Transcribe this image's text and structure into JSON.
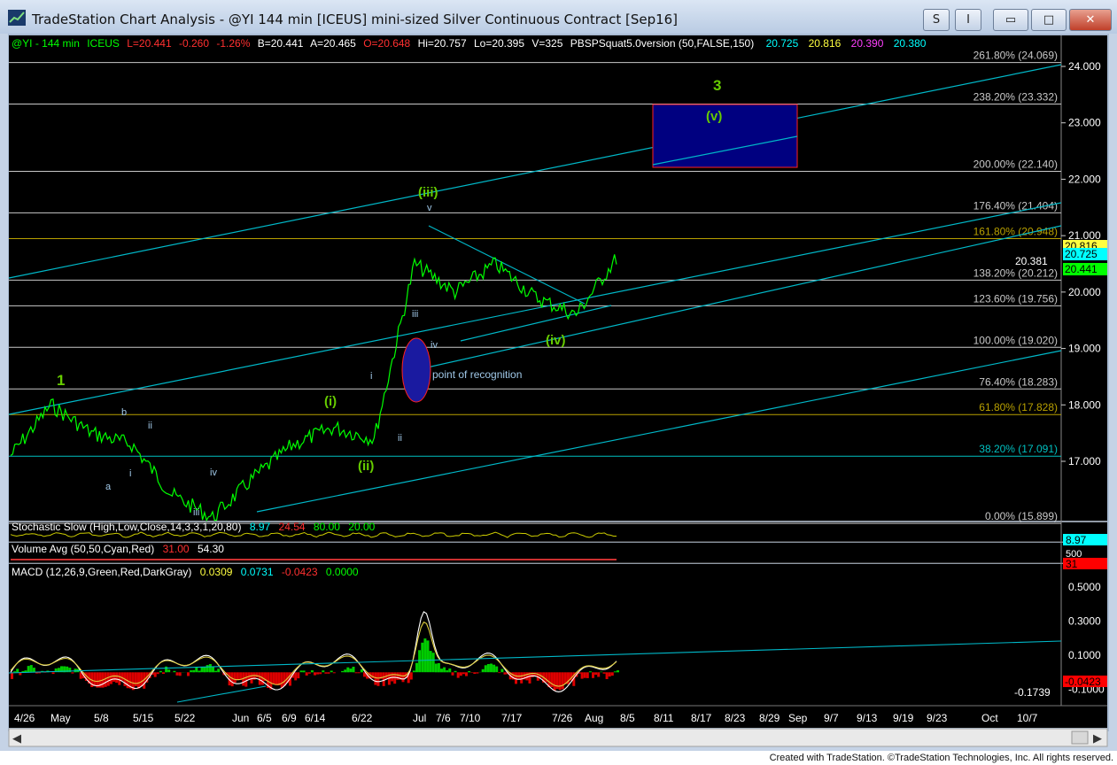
{
  "window": {
    "title": "TradeStation Chart Analysis - @YI 144 min [ICEUS] mini-sized Silver Continuous Contract [Sep16]",
    "buttons": {
      "s_menu": "S",
      "i_menu": "I",
      "minimize": "▭",
      "maximize": "□",
      "close": "✕"
    }
  },
  "footer": "Created with TradeStation. ©TradeStation Technologies, Inc. All rights reserved.",
  "colors": {
    "background": "#000000",
    "price": "#00ff00",
    "channel": "#00c0c0",
    "fib": "#c8c8c8",
    "wave_label": "#66cc00",
    "target_box": "#00007a"
  },
  "header": {
    "symbol": "@YI - 144 min",
    "exchange": "ICEUS",
    "last": "L=20.441",
    "change": "-0.260",
    "change_pct": "-1.26%",
    "bid": "B=20.441",
    "ask": "A=20.465",
    "open": "O=20.648",
    "high": "Hi=20.757",
    "low": "Lo=20.395",
    "volume": "V=325",
    "study": "PBSPSquat5.0version (50,FALSE,150)",
    "v1": "20.725",
    "v2": "20.816",
    "v3": "20.390",
    "v4": "20.380"
  },
  "price_axis": {
    "ticks": [
      "24.000",
      "23.000",
      "22.000",
      "21.000",
      "20.000",
      "19.000",
      "18.000",
      "17.000"
    ]
  },
  "fib_levels": [
    {
      "label": "261.80% (24.069)",
      "value": 24.069,
      "color": "#c8c8c8"
    },
    {
      "label": "238.20% (23.332)",
      "value": 23.332,
      "color": "#c8c8c8"
    },
    {
      "label": "200.00% (22.140)",
      "value": 22.14,
      "color": "#c8c8c8"
    },
    {
      "label": "176.40% (21.404)",
      "value": 21.404,
      "color": "#c8c8c8"
    },
    {
      "label": "161.80% (20.948)",
      "value": 20.948,
      "color": "#b8a000"
    },
    {
      "label": "138.20% (20.212)",
      "value": 20.212,
      "color": "#c8c8c8"
    },
    {
      "label": "123.60% (19.756)",
      "value": 19.756,
      "color": "#c8c8c8"
    },
    {
      "label": "100.00% (19.020)",
      "value": 19.02,
      "color": "#c8c8c8"
    },
    {
      "label": "76.40% (18.283)",
      "value": 18.283,
      "color": "#c8c8c8"
    },
    {
      "label": "61.80% (17.828)",
      "value": 17.828,
      "color": "#b8a000"
    },
    {
      "label": "38.20% (17.091)",
      "value": 17.091,
      "color": "#00c0c0"
    },
    {
      "label": "0.00% (15.899)",
      "value": 15.899,
      "color": "#c8c8c8"
    }
  ],
  "price_tags": [
    {
      "text": "20.816",
      "color": "#ffff40",
      "text_color": "#000000"
    },
    {
      "text": "20.725",
      "color": "#00ffff",
      "text_color": "#000000"
    },
    {
      "text": "20.441",
      "color": "#00ff00",
      "text_color": "#000000"
    }
  ],
  "annotations": {
    "wave_3": "3",
    "wave_v_target": "(v)",
    "wave_iii": "(iii)",
    "wave_1": "1",
    "wave_i": "(i)",
    "wave_ii": "(ii)",
    "wave_iv": "(iv)",
    "point_of_recognition": "point of recognition",
    "level_20381": "20.381",
    "sub_labels": [
      "v",
      "iii",
      "iv",
      "i",
      "ii",
      "b",
      "ii",
      "a",
      "i",
      "iv",
      "iii"
    ]
  },
  "stochastic": {
    "label": "Stochastic Slow (High,Low,Close,14,3,3,1,20,80)",
    "k": "8.97",
    "d": "24.54",
    "ob": "80.00",
    "os": "20.00",
    "tag": "8.97"
  },
  "volume": {
    "label": "Volume Avg (50,50,Cyan,Red)",
    "v1": "31.00",
    "v2": "54.30",
    "tag_top": "500",
    "tag": "31"
  },
  "macd": {
    "label": "MACD (12,26,9,Green,Red,DarkGray)",
    "macd": "0.0309",
    "signal": "0.0731",
    "diff": "-0.0423",
    "zero": "0.0000",
    "ticks": [
      "0.5000",
      "0.3000",
      "0.1000",
      "-0.1000"
    ],
    "tag": "-0.0423",
    "min_label": "-0.1739"
  },
  "x_axis": {
    "labels": [
      "4/26",
      "May",
      "5/8",
      "5/15",
      "5/22",
      "Jun",
      "6/5",
      "6/9",
      "6/14",
      "6/22",
      "Jul",
      "7/6",
      "7/10",
      "7/17",
      "7/26",
      "Aug",
      "8/5",
      "8/11",
      "8/17",
      "8/23",
      "8/29",
      "Sep",
      "9/7",
      "9/13",
      "9/19",
      "9/23",
      "Oct",
      "10/7"
    ]
  },
  "chart_data": {
    "type": "line",
    "title": "TradeStation Chart Analysis - @YI 144 min [ICEUS] mini-sized Silver Continuous Contract [Sep16]",
    "xlabel": "",
    "ylabel": "",
    "ylim": [
      15.9,
      24.3
    ],
    "x": [
      "4/26",
      "May",
      "5/8",
      "5/15",
      "5/22",
      "Jun",
      "6/5",
      "6/9",
      "6/14",
      "6/22",
      "Jul",
      "7/6",
      "7/10",
      "7/17",
      "7/26",
      "Aug"
    ],
    "series": [
      {
        "name": "@YI",
        "values": [
          17.1,
          18.0,
          17.5,
          17.3,
          16.4,
          16.0,
          16.7,
          17.3,
          17.6,
          17.4,
          20.5,
          20.0,
          20.5,
          19.9,
          19.6,
          20.6
        ]
      }
    ],
    "stochastic_k_last": 8.97,
    "stochastic_d_last": 24.54,
    "macd_last": 0.0309,
    "macd_signal_last": 0.0731,
    "macd_diff_last": -0.0423,
    "macd_min": -0.1739,
    "target_zone": {
      "low": 22.14,
      "high": 23.332,
      "label": "(v)"
    }
  }
}
